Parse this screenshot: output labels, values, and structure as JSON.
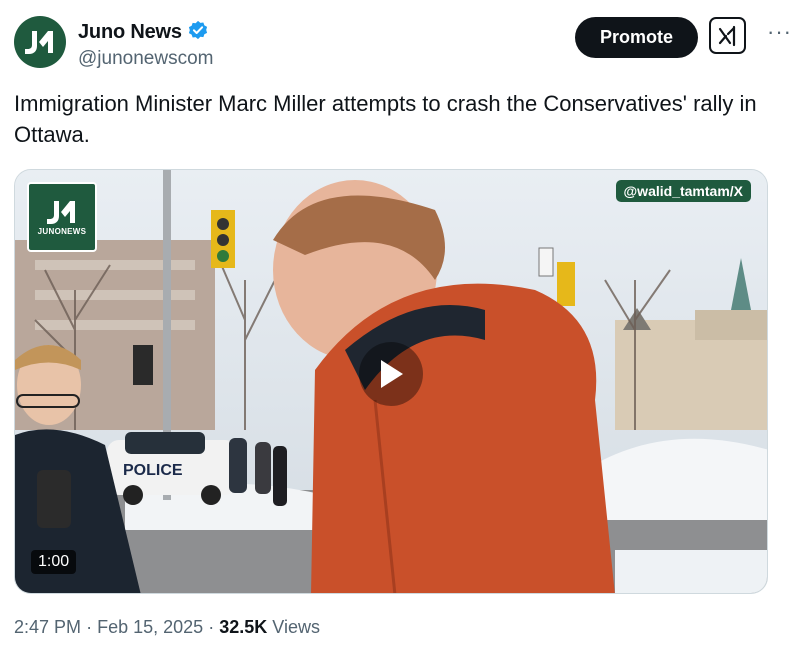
{
  "author": {
    "display_name": "Juno News",
    "handle": "@junonewscom",
    "verified": true,
    "avatar_color": "#1f5a3e"
  },
  "actions": {
    "promote_label": "Promote",
    "grok_icon": "grok-icon",
    "more_icon": "more-icon"
  },
  "tweet": {
    "text": "Immigration Minister Marc Miller attempts to crash the Conservatives' rally in Ottawa."
  },
  "media": {
    "logo_text": "JUNONEWS",
    "credit": "@walid_tamtam/X",
    "duration": "1:00",
    "police_text": "POLICE",
    "play_icon": "play-icon"
  },
  "meta": {
    "time": "2:47 PM",
    "separator": "·",
    "date": "Feb 15, 2025",
    "views_count": "32.5K",
    "views_label": "Views"
  },
  "colors": {
    "brand_green": "#1f5a3e",
    "verified_blue": "#1d9bf0",
    "text_primary": "#0f1419",
    "text_secondary": "#536471"
  }
}
